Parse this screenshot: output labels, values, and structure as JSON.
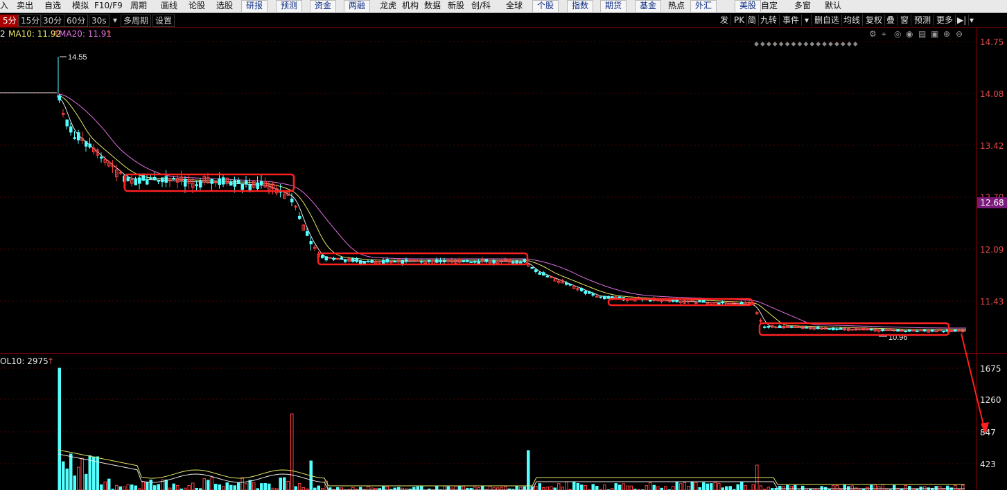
{
  "menu": {
    "items": [
      "入",
      "卖出",
      "自选",
      "模拟",
      "F10/F9",
      "周期",
      "画线",
      "论股",
      "选股",
      "研报",
      "预测",
      "资金",
      "两融",
      "龙虎",
      "机构",
      "数据",
      "新股",
      "创/科",
      "全球",
      "个股",
      "指数",
      "期货",
      "基金",
      "热点",
      "外汇",
      "美股",
      "自定",
      "多窗",
      "默认"
    ],
    "tab_items": [
      "研报",
      "预测",
      "资金",
      "两融",
      "个股",
      "指数",
      "期货",
      "基金",
      "外汇",
      "美股"
    ]
  },
  "toolbar": {
    "periods": [
      "5分",
      "15分",
      "30分",
      "60分",
      "30s"
    ],
    "active_period": "5分",
    "extra": [
      "多周期",
      "设置"
    ],
    "right_buttons": [
      "发",
      "PK",
      "简",
      "九转",
      "事件",
      "删自选",
      "均线",
      "复权",
      "叠",
      "窗",
      "预测",
      "更多"
    ]
  },
  "indicators": {
    "ma_prefix": "2",
    "ma10_label": "MA10: 11.92",
    "ma20_label": "MA20: 11.91",
    "ma10_color": "#e8e86a",
    "ma20_color": "#e070e0",
    "vol_label": "OL10: 2975"
  },
  "price_axis": [
    "14.75",
    "14.08",
    "13.42",
    "12.70",
    "12.09",
    "11.43"
  ],
  "current_price": "12.68",
  "volume_axis": [
    "1675",
    "1260",
    "847",
    "423"
  ],
  "annotations": {
    "high_label": "14.55",
    "low_label": "10.96"
  },
  "colors": {
    "up": "#ff4040",
    "down": "#54ffff",
    "axis": "#e24b4b",
    "highlight_box": "#ff2020"
  },
  "icons": [
    "gear-icon",
    "pin-icon",
    "compass-icon",
    "eye-icon",
    "print-icon",
    "lock-icon",
    "zoom-in-icon",
    "zoom-out-icon"
  ]
}
